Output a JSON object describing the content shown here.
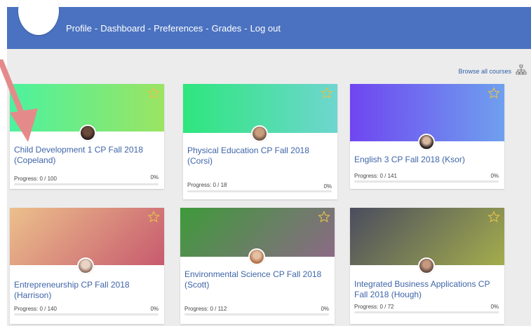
{
  "nav": {
    "items": [
      {
        "label": "Profile"
      },
      {
        "label": "Dashboard"
      },
      {
        "label": "Preferences"
      },
      {
        "label": "Grades"
      },
      {
        "label": "Log out"
      }
    ],
    "separator": "-"
  },
  "browse_label": "Browse all courses",
  "courses": [
    {
      "title": "Child Development 1 CP Fall 2018 (Copeland)",
      "progress": "Progress: 0 / 100",
      "percent": "0%",
      "progress_value": 0,
      "banner_from": "#4cf29e",
      "banner_to": "#9be463",
      "starred": false
    },
    {
      "title": "Physical Education CP Fall 2018 (Corsi)",
      "progress": "Progress: 0 / 18",
      "percent": "0%",
      "progress_value": 0,
      "banner_from": "#2ee67d",
      "banner_to": "#6ed6cf",
      "starred": false
    },
    {
      "title": "English 3 CP Fall 2018 (Ksor)",
      "progress": "Progress: 0 / 141",
      "percent": "0%",
      "progress_value": 0,
      "banner_from": "#6f46f1",
      "banner_to": "#6fa0ee",
      "starred": false
    },
    {
      "title": "Entrepreneurship CP Fall 2018 (Harrison)",
      "progress": "Progress: 0 / 140",
      "percent": "0%",
      "progress_value": 0,
      "banner_from": "#ecc08c",
      "banner_to": "#c75a6e",
      "starred": false
    },
    {
      "title": "Environmental Science CP Fall 2018 (Scott)",
      "progress": "Progress: 0 / 112",
      "percent": "0%",
      "progress_value": 0,
      "banner_from": "#3e9a3a",
      "banner_to": "#8b6a86",
      "starred": false
    },
    {
      "title": "Integrated Business Applications CP Fall 2018 (Hough)",
      "progress": "Progress: 0 / 72",
      "percent": "0%",
      "progress_value": 0,
      "banner_from": "#4a4d5e",
      "banner_to": "#a4ad4d",
      "starred": false
    }
  ],
  "colors": {
    "header": "#4a72c0",
    "link": "#3e64a8",
    "star": "#e4c14a",
    "arrow": "#e58a8a"
  }
}
